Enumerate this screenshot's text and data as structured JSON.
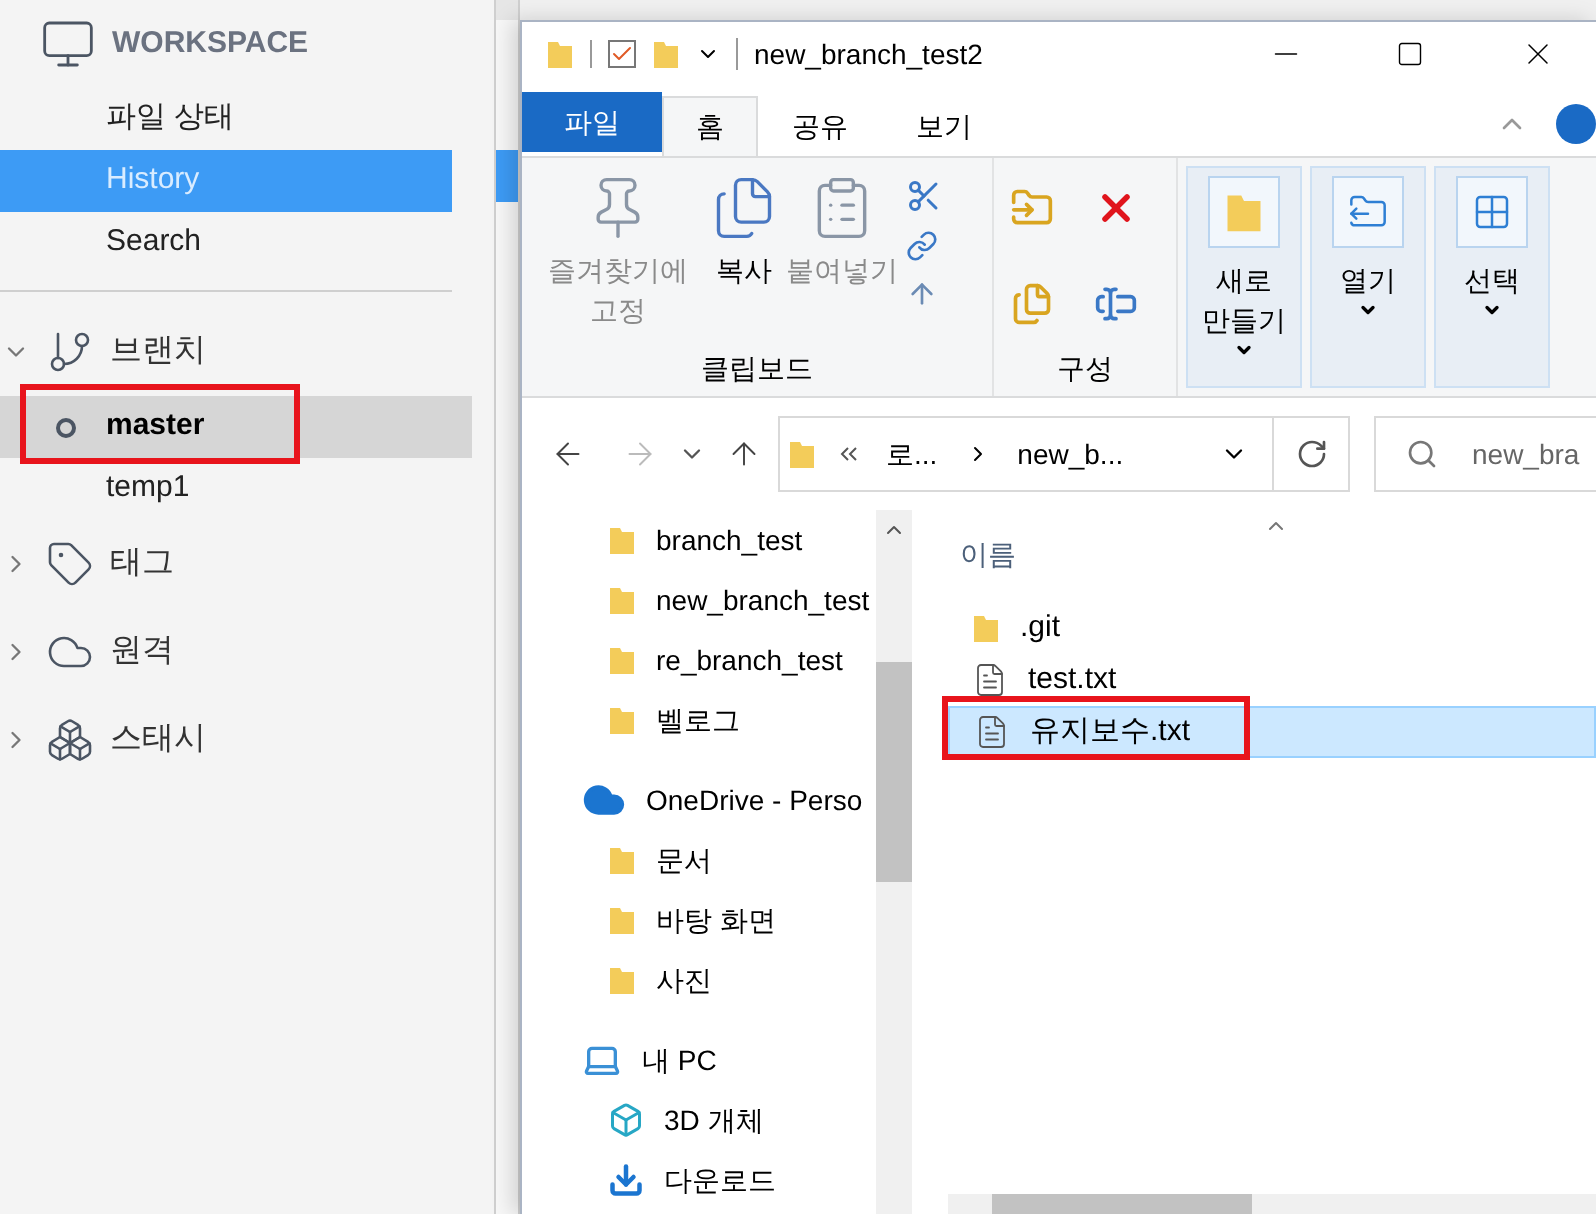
{
  "sidebar": {
    "workspace": {
      "title": "WORKSPACE",
      "items": [
        {
          "label": "파일 상태",
          "selected": false
        },
        {
          "label": "History",
          "selected": true
        },
        {
          "label": "Search",
          "selected": false
        }
      ]
    },
    "sections": [
      {
        "kind": "branch",
        "label": "브랜치",
        "expanded": true,
        "children": [
          {
            "label": "master",
            "current": true,
            "selected": true,
            "highlighted": true
          },
          {
            "label": "temp1",
            "current": false,
            "selected": false,
            "highlighted": false
          }
        ]
      },
      {
        "kind": "tag",
        "label": "태그",
        "expanded": false
      },
      {
        "kind": "remote",
        "label": "원격",
        "expanded": false
      },
      {
        "kind": "stash",
        "label": "스태시",
        "expanded": false
      }
    ]
  },
  "explorer": {
    "title": "new_branch_test2",
    "ribbon_tabs": [
      {
        "label": "파일",
        "kind": "file"
      },
      {
        "label": "홈",
        "kind": "tab",
        "selected": true
      },
      {
        "label": "공유",
        "kind": "tab",
        "selected": false
      },
      {
        "label": "보기",
        "kind": "tab",
        "selected": false
      }
    ],
    "clipboard_group": {
      "label": "클립보드",
      "buttons": [
        {
          "kind": "pin",
          "label": "즐겨찾기에 고정",
          "disabled": true
        },
        {
          "kind": "copy",
          "label": "복사",
          "disabled": false
        },
        {
          "kind": "paste",
          "label": "붙여넣기",
          "disabled": true
        }
      ]
    },
    "organize_group": {
      "label": "구성"
    },
    "large_buttons": [
      {
        "kind": "new",
        "label": "새로 만들기"
      },
      {
        "kind": "open",
        "label": "열기"
      },
      {
        "kind": "select",
        "label": "선택"
      }
    ],
    "address": {
      "segments": [
        "로...",
        "new_b..."
      ]
    },
    "search": {
      "placeholder": "new_bra"
    },
    "nav_tree": [
      {
        "kind": "folder",
        "label": "branch_test"
      },
      {
        "kind": "folder",
        "label": "new_branch_test"
      },
      {
        "kind": "folder",
        "label": "re_branch_test"
      },
      {
        "kind": "folder",
        "label": "벨로그"
      },
      {
        "kind": "onedrive",
        "label": "OneDrive - Perso"
      },
      {
        "kind": "folder",
        "label": "문서"
      },
      {
        "kind": "folder",
        "label": "바탕 화면"
      },
      {
        "kind": "folder",
        "label": "사진"
      },
      {
        "kind": "pc",
        "label": "내 PC"
      },
      {
        "kind": "cube",
        "label": "3D 개체"
      },
      {
        "kind": "download",
        "label": "다운로드"
      }
    ],
    "column_header": "이름",
    "files": [
      {
        "kind": "folder",
        "name": ".git",
        "selected": false,
        "highlighted": false
      },
      {
        "kind": "text",
        "name": "test.txt",
        "selected": false,
        "highlighted": false
      },
      {
        "kind": "text",
        "name": "유지보수.txt",
        "selected": true,
        "highlighted": true
      }
    ]
  }
}
